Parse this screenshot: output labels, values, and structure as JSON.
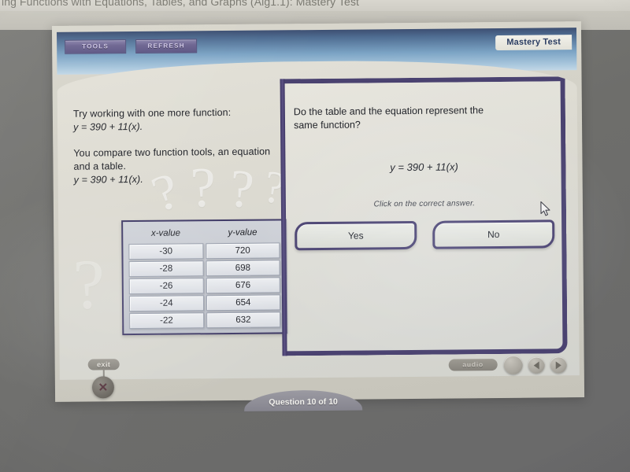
{
  "browser": {
    "page_title": "ing Functions with Equations, Tables, and Graphs (Alg1.1): Mastery Test"
  },
  "header": {
    "tools_label": "TOOLS",
    "refresh_label": "REFRESH",
    "mastery_badge": "Mastery Test"
  },
  "left_panel": {
    "intro_line1": "Try working with one more function:",
    "intro_line2": "y = 390 + 11(x).",
    "body_line1": "You compare two function tools, an equation",
    "body_line2": "and a table.",
    "body_line3": "y = 390 + 11(x)."
  },
  "table": {
    "columns": [
      "x-value",
      "y-value"
    ],
    "rows": [
      [
        "-30",
        "720"
      ],
      [
        "-28",
        "698"
      ],
      [
        "-26",
        "676"
      ],
      [
        "-24",
        "654"
      ],
      [
        "-22",
        "632"
      ]
    ]
  },
  "right_panel": {
    "question_line1": "Do the table and the equation represent the",
    "question_line2": "same function?",
    "equation": "y = 390 + 11(x)",
    "instruction": "Click on the correct answer.",
    "answers": [
      "Yes",
      "No"
    ]
  },
  "footer": {
    "exit_label": "exit",
    "exit_icon": "close-x-icon",
    "question_counter": "Question 10 of 10",
    "audio_label": "audio",
    "prev_icon": "triangle-left-icon",
    "next_icon": "triangle-right-icon"
  },
  "watermarks": [
    "?",
    "?",
    "?",
    "?",
    "?"
  ],
  "colors": {
    "frame_purple": "#4a4270",
    "header_blue": "#7ba3c4",
    "card_bg": "#dcdad1",
    "toolbar_button": "#6d6591"
  }
}
